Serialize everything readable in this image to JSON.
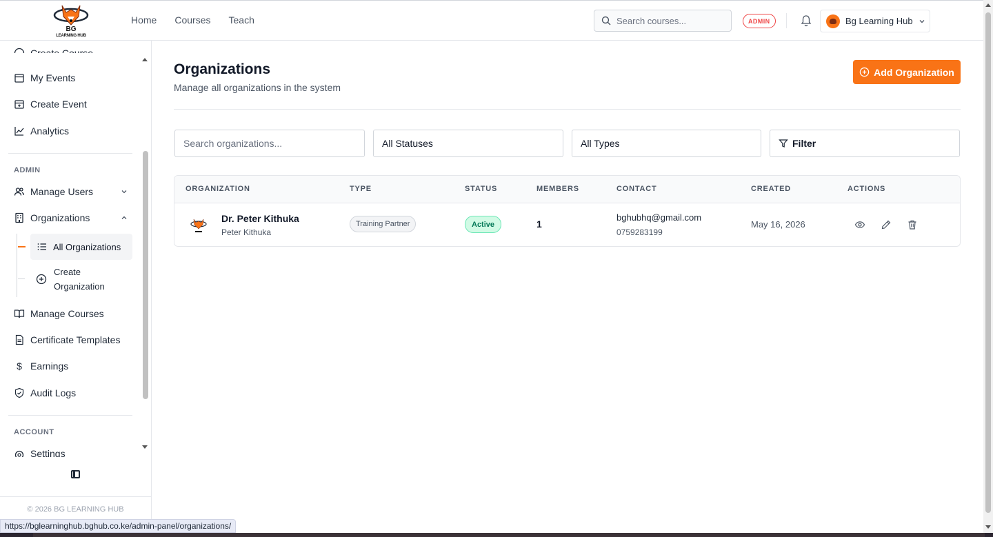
{
  "header": {
    "logo_line1": "BG",
    "logo_line2": "LEARNING HUB",
    "nav": [
      "Home",
      "Courses",
      "Teach"
    ],
    "search_placeholder": "Search courses...",
    "admin_badge": "ADMIN",
    "user_name": "Bg Learning Hub"
  },
  "sidebar": {
    "partial_top": "Create Course",
    "items_top": [
      "My Events",
      "Create Event",
      "Analytics"
    ],
    "admin_label": "ADMIN",
    "manage_users": "Manage Users",
    "organizations": "Organizations",
    "sub_all": "All Organizations",
    "sub_create_line1": "Create",
    "sub_create_line2": "Organization",
    "items_bottom": [
      "Manage Courses",
      "Certificate Templates",
      "Earnings",
      "Audit Logs"
    ],
    "account_label": "ACCOUNT",
    "partial_bottom": "Settings",
    "copyright": "© 2026 BG LEARNING HUB"
  },
  "main": {
    "title": "Organizations",
    "subtitle": "Manage all organizations in the system",
    "add_button": "Add Organization",
    "filters": {
      "search_placeholder": "Search organizations...",
      "status": "All Statuses",
      "type": "All Types",
      "filter_button": "Filter"
    },
    "table": {
      "headers": [
        "ORGANIZATION",
        "TYPE",
        "STATUS",
        "MEMBERS",
        "CONTACT",
        "CREATED",
        "ACTIONS"
      ],
      "rows": [
        {
          "name": "Dr. Peter Kithuka",
          "subname": "Peter Kithuka",
          "type": "Training Partner",
          "status": "Active",
          "members": "1",
          "email": "bghubhq@gmail.com",
          "phone": "0759283199",
          "created": "May 16, 2026"
        }
      ]
    }
  },
  "status_bar_url": "https://bglearninghub.bghub.co.ke/admin-panel/organizations/",
  "colors": {
    "accent": "#f97316",
    "active_bg": "#d1fae5",
    "active_text": "#047857",
    "admin_red": "#ef4444"
  }
}
